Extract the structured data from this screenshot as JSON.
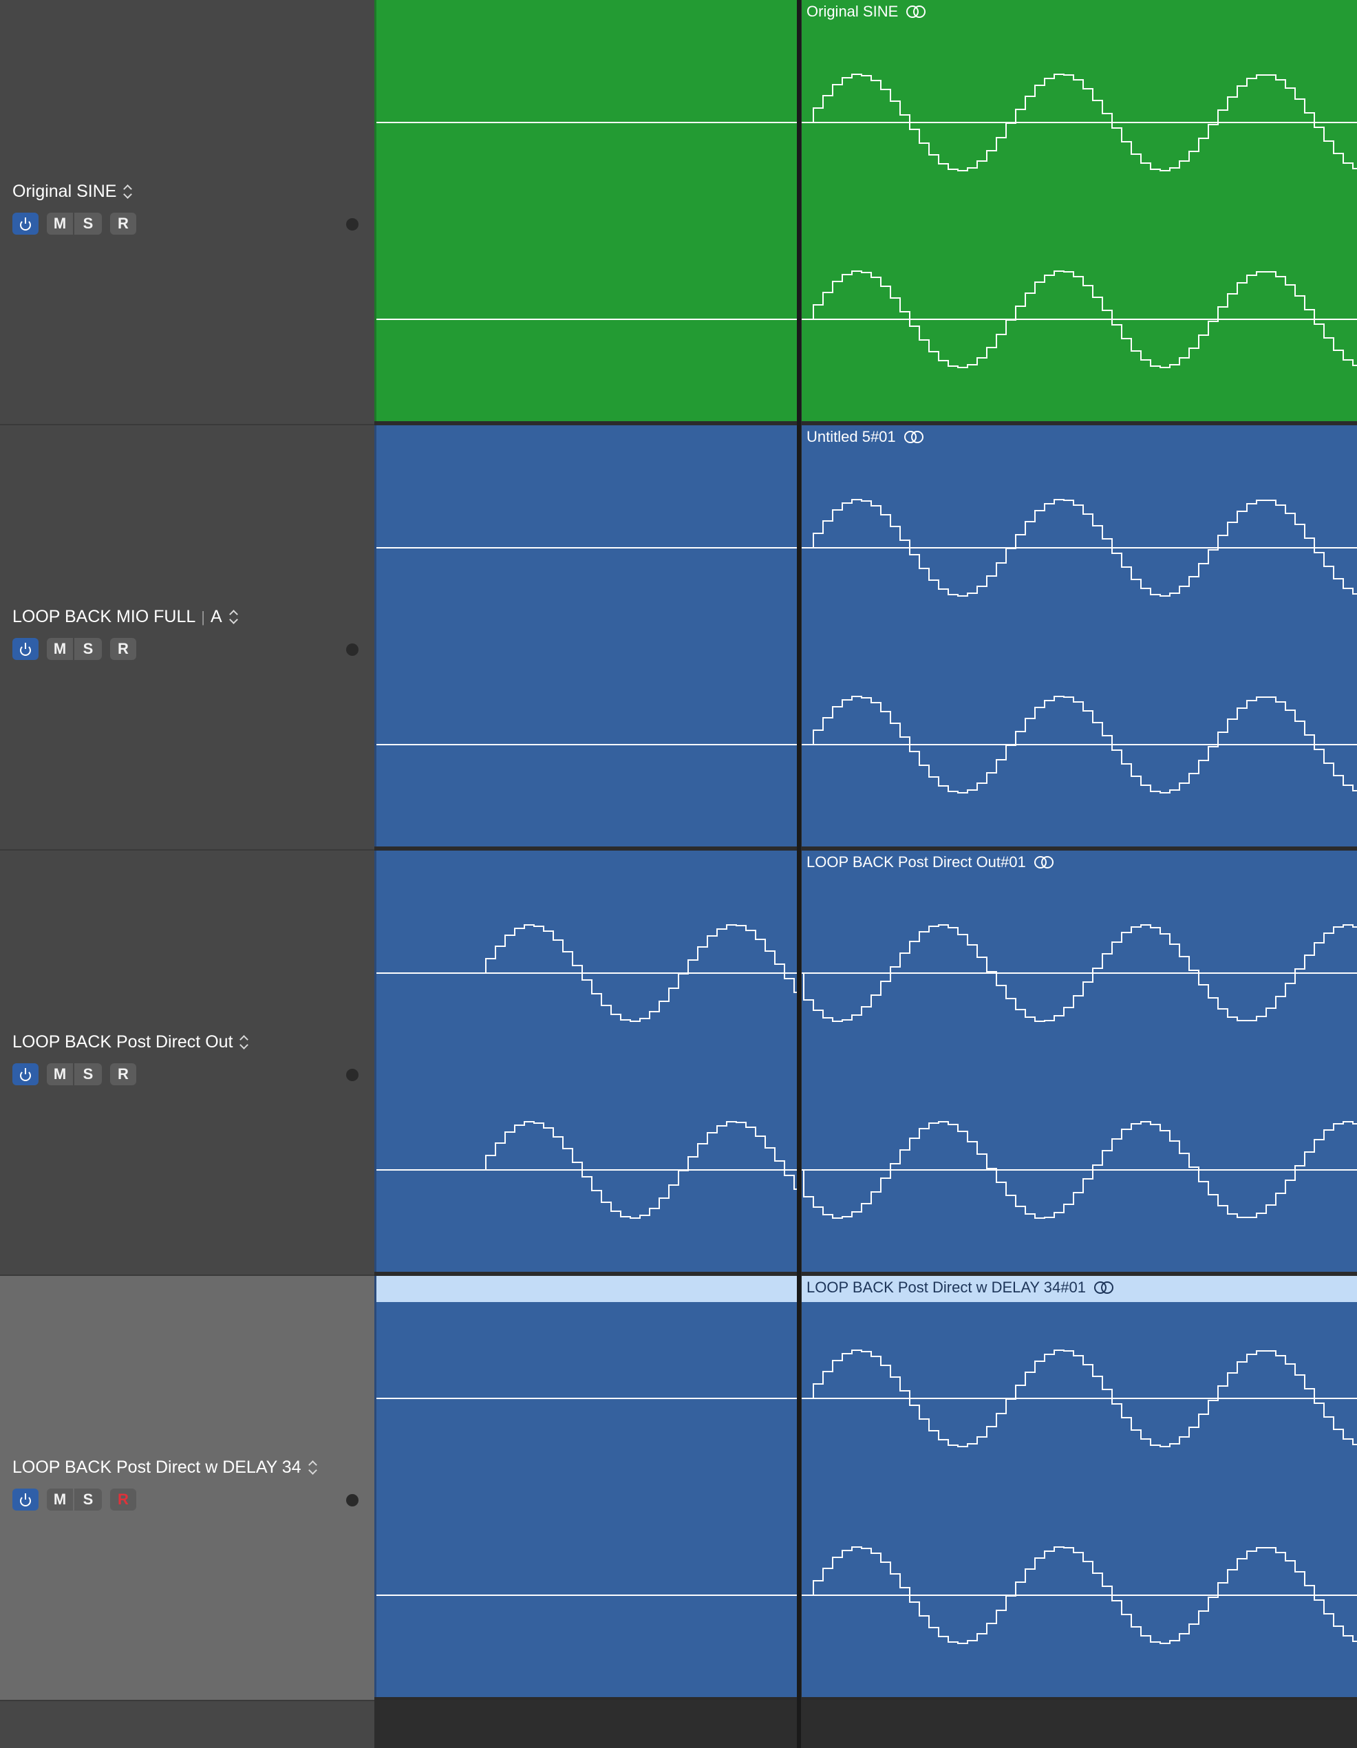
{
  "tracks": [
    {
      "name": "Original SINE",
      "suffix": "",
      "color": "#239b33",
      "selected": false,
      "buttons": {
        "mute": "M",
        "solo": "S",
        "record": "R"
      },
      "record_armed": false,
      "region_title": "Original SINE",
      "left_has_wave": false,
      "right_phase": 0
    },
    {
      "name": "LOOP BACK MIO FULL",
      "suffix": "A",
      "color": "#35619e",
      "selected": false,
      "buttons": {
        "mute": "M",
        "solo": "S",
        "record": "R"
      },
      "record_armed": false,
      "region_title": "Untitled 5#01",
      "left_has_wave": false,
      "right_phase": 0
    },
    {
      "name": "LOOP BACK Post Direct Out",
      "suffix": "",
      "color": "#35619e",
      "selected": false,
      "buttons": {
        "mute": "M",
        "solo": "S",
        "record": "R"
      },
      "record_armed": false,
      "region_title": "LOOP BACK Post Direct Out#01",
      "left_has_wave": true,
      "right_phase": 1
    },
    {
      "name": "LOOP BACK Post Direct w DELAY 34",
      "suffix": "",
      "color": "#35619e",
      "selected": true,
      "buttons": {
        "mute": "M",
        "solo": "S",
        "record": "R"
      },
      "record_armed": true,
      "region_title": "LOOP BACK Post Direct w DELAY 34#01",
      "left_has_wave": false,
      "right_phase": 0
    }
  ]
}
